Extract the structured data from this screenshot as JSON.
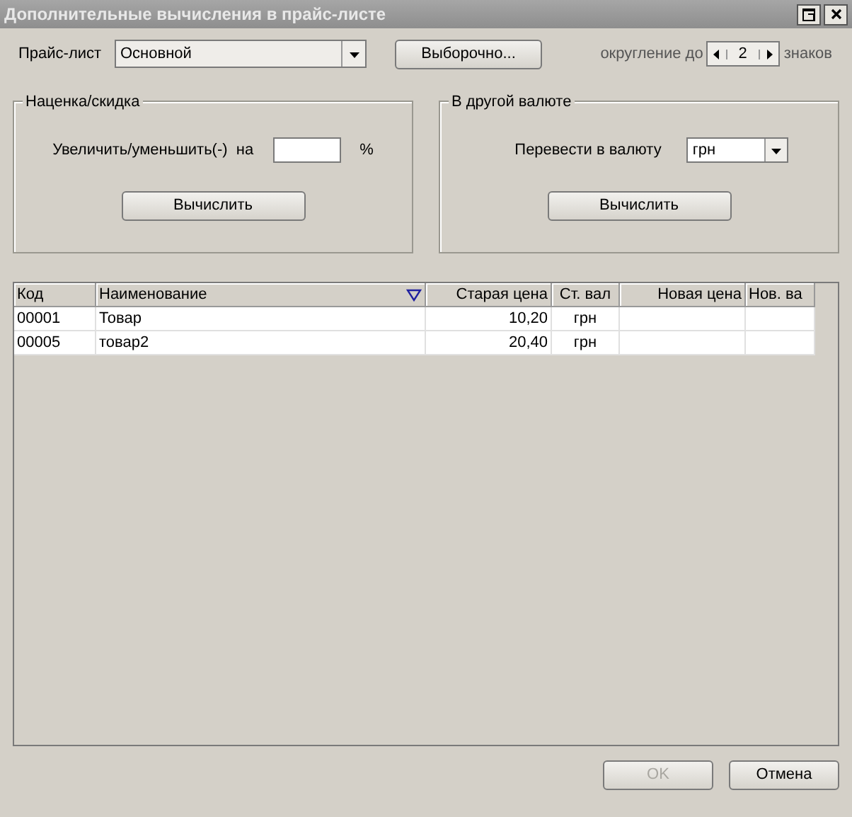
{
  "window": {
    "title": "Дополнительные вычисления в прайс-листе"
  },
  "price_list": {
    "label": "Прайс-лист",
    "value": "Основной",
    "select_button": "Выборочно..."
  },
  "rounding": {
    "label": "округление до",
    "value": "2",
    "suffix": "знаков"
  },
  "markup_group": {
    "title": "Наценка/скидка",
    "label": "Увеличить/уменьшить(-)  на",
    "unit": "%",
    "button": "Вычислить"
  },
  "currency_group": {
    "title": "В другой валюте",
    "label": "Перевести в валюту",
    "value": "грн",
    "button": "Вычислить"
  },
  "table": {
    "columns": [
      {
        "label": "Код",
        "sorted": false
      },
      {
        "label": "Наименование",
        "sorted": true
      },
      {
        "label": "Старая цена",
        "sorted": false
      },
      {
        "label": "Ст. вал",
        "sorted": false
      },
      {
        "label": "Новая цена",
        "sorted": false
      },
      {
        "label": "Нов. ва",
        "sorted": false
      }
    ],
    "rows": [
      [
        "00001",
        "Товар",
        "10,20",
        "грн",
        "",
        ""
      ],
      [
        "00005",
        "товар2",
        "20,40",
        "грн",
        "",
        ""
      ]
    ]
  },
  "buttons": [
    {
      "label": "OK",
      "disabled": true
    },
    {
      "label": "Отмена",
      "disabled": false
    }
  ]
}
